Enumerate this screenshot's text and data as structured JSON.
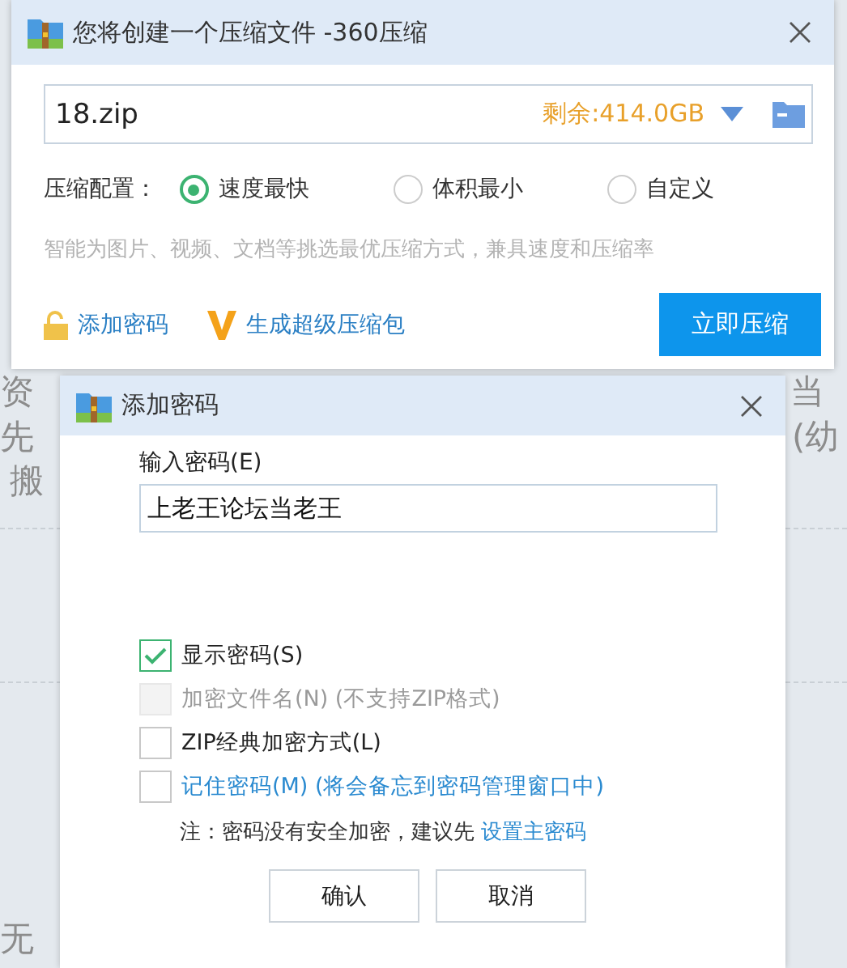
{
  "background_page": {
    "fragments": [
      "资",
      "当",
      "先",
      "(幼",
      "搬",
      "无"
    ]
  },
  "compress_dialog": {
    "title": "您将创建一个压缩文件 -360压缩",
    "filename": "18.zip",
    "free_space": "剩余:414.0GB",
    "config_label": "压缩配置：",
    "options": [
      {
        "label": "速度最快",
        "selected": true
      },
      {
        "label": "体积最小",
        "selected": false
      },
      {
        "label": "自定义",
        "selected": false
      }
    ],
    "hint": "智能为图片、视频、文档等挑选最优压缩方式，兼具速度和压缩率",
    "add_password_link": "添加密码",
    "super_pack_link": "生成超级压缩包",
    "compress_button": "立即压缩"
  },
  "password_dialog": {
    "title": "添加密码",
    "input_label": "输入密码(E)",
    "input_value": "上老王论坛当老王",
    "options": [
      {
        "label": "显示密码(S)",
        "kind": "plain",
        "checked": true,
        "disabled": false
      },
      {
        "label": "加密文件名(N) (不支持ZIP格式)",
        "kind": "plain",
        "checked": false,
        "disabled": true
      },
      {
        "label": "ZIP经典加密方式(L)",
        "kind": "plain",
        "checked": false,
        "disabled": false
      },
      {
        "label": "记住密码(M) (将会备忘到密码管理窗口中)",
        "kind": "link",
        "checked": false,
        "disabled": false
      }
    ],
    "note": "注：密码没有安全加密，建议先",
    "note_link": "设置主密码",
    "buttons": [
      "确认",
      "取消"
    ]
  }
}
